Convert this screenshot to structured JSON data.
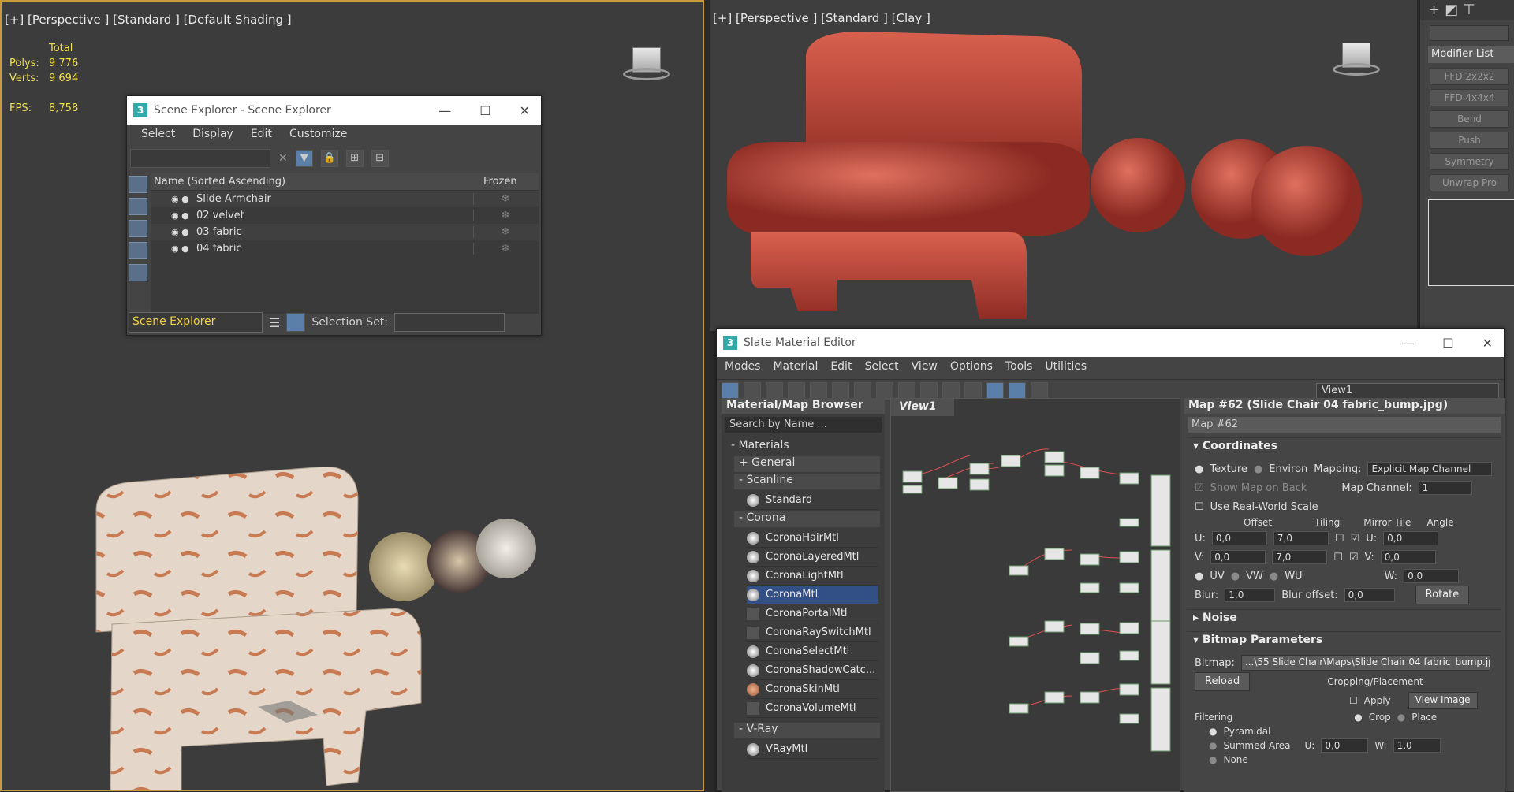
{
  "left_viewport": {
    "label": "[+] [Perspective ] [Standard ] [Default Shading ]",
    "stats": {
      "total_label": "Total",
      "polys_label": "Polys:",
      "polys_value": "9 776",
      "verts_label": "Verts:",
      "verts_value": "9 694",
      "fps_label": "FPS:",
      "fps_value": "8,758"
    }
  },
  "right_viewport": {
    "label": "[+] [Perspective ] [Standard ] [Clay ]"
  },
  "command_panel": {
    "modifier_list": "Modifier List",
    "modifiers": [
      "FFD 2x2x2",
      "FFD 4x4x4",
      "Bend",
      "Push",
      "Symmetry",
      "Unwrap Pro"
    ]
  },
  "scene_explorer": {
    "title": "Scene Explorer - Scene Explorer",
    "menus": [
      "Select",
      "Display",
      "Edit",
      "Customize"
    ],
    "columns": {
      "name": "Name (Sorted Ascending)",
      "frozen": "Frozen"
    },
    "rows": [
      "Slide Armchair",
      "02 velvet",
      "03 fabric",
      "04 fabric"
    ],
    "explorer_dropdown": "Scene Explorer",
    "selection_set_label": "Selection Set:"
  },
  "slate": {
    "title": "Slate Material Editor",
    "menus": [
      "Modes",
      "Material",
      "Edit",
      "Select",
      "View",
      "Options",
      "Tools",
      "Utilities"
    ],
    "view_dropdown": "View1",
    "browser": {
      "title": "Material/Map Browser",
      "search_placeholder": "Search by Name ...",
      "materials_group": "- Materials",
      "general": "+ General",
      "scanline": "- Scanline",
      "standard": "Standard",
      "corona": "- Corona",
      "corona_items": [
        "CoronaHairMtl",
        "CoronaLayeredMtl",
        "CoronaLightMtl",
        "CoronaMtl",
        "CoronaPortalMtl",
        "CoronaRaySwitchMtl",
        "CoronaSelectMtl",
        "CoronaShadowCatc...",
        "CoronaSkinMtl",
        "CoronaVolumeMtl"
      ],
      "vray": "- V-Ray",
      "vray_items": [
        "VRayMtl"
      ]
    },
    "view_tab": "View1",
    "params": {
      "title": "Map #62 (Slide Chair 04 fabric_bump.jpg)",
      "map_name": "Map #62",
      "coordinates": "Coordinates",
      "texture": "Texture",
      "environ": "Environ",
      "mapping_label": "Mapping:",
      "mapping_value": "Explicit Map Channel",
      "show_map_on_back": "Show Map on Back",
      "map_channel_label": "Map Channel:",
      "map_channel_value": "1",
      "use_real_world": "Use Real-World Scale",
      "offset": "Offset",
      "tiling": "Tiling",
      "mirror_tile": "Mirror Tile",
      "angle": "Angle",
      "u_label": "U:",
      "v_label": "V:",
      "w_label": "W:",
      "u_offset": "0,0",
      "v_offset": "0,0",
      "u_tiling": "7,0",
      "v_tiling": "7,0",
      "u_angle": "0,0",
      "v_angle": "0,0",
      "w_angle": "0,0",
      "uv": "UV",
      "vw": "VW",
      "wu": "WU",
      "blur_label": "Blur:",
      "blur_value": "1,0",
      "blur_offset_label": "Blur offset:",
      "blur_offset_value": "0,0",
      "rotate": "Rotate",
      "noise": "Noise",
      "bitmap_params": "Bitmap Parameters",
      "bitmap_label": "Bitmap:",
      "bitmap_path": "...\\55 Slide Chair\\Maps\\Slide Chair 04 fabric_bump.jpg",
      "reload": "Reload",
      "cropping": "Cropping/Placement",
      "apply": "Apply",
      "view_image": "View Image",
      "filtering": "Filtering",
      "pyramidal": "Pyramidal",
      "summed_area": "Summed Area",
      "none": "None",
      "crop": "Crop",
      "place": "Place",
      "crop_u": "0,0",
      "crop_w": "1,0"
    }
  }
}
